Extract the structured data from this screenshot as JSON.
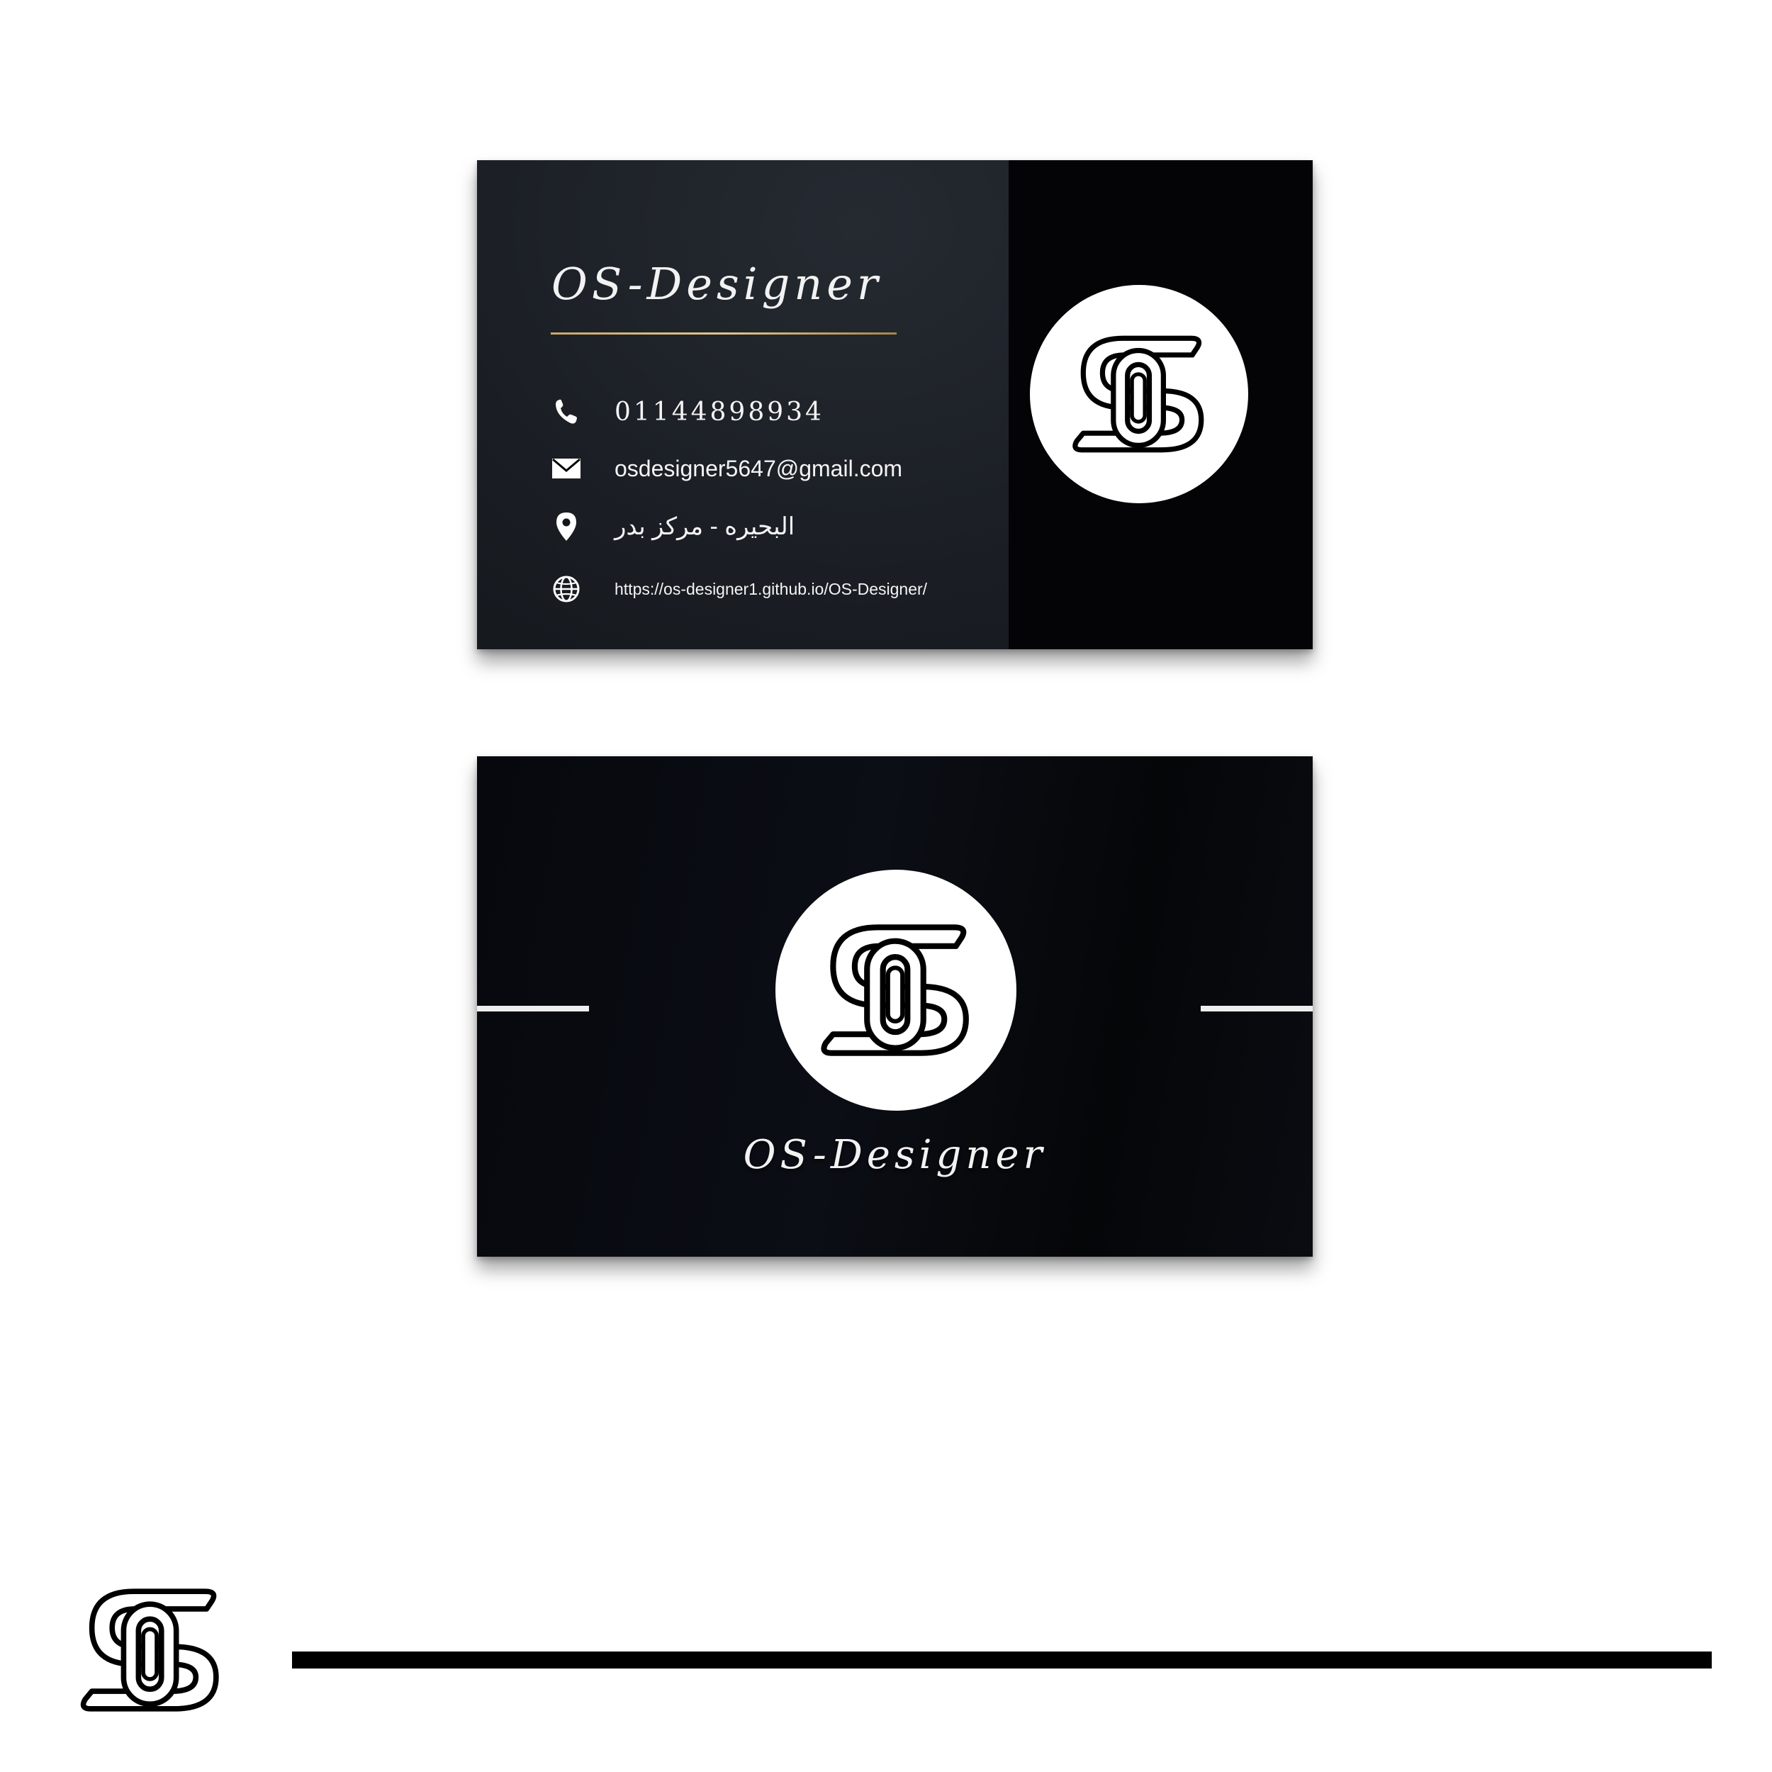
{
  "brand": {
    "name": "OS-Designer",
    "logo": "os-monogram-logo"
  },
  "front": {
    "title": "OS-Designer",
    "contacts": {
      "phone": "01144898934",
      "email": "osdesigner5647@gmail.com",
      "address": "البحيره - مركز بدر",
      "website": "https://os-designer1.github.io/OS-Designer/"
    },
    "icons": {
      "phone": "phone-icon",
      "email": "envelope-icon",
      "address": "location-pin-icon",
      "website": "globe-icon"
    }
  },
  "back": {
    "title": "OS-Designer"
  },
  "colors": {
    "card_background": "#040406",
    "accent_gold": "#c9a86a",
    "text": "#f2f2f2",
    "page_background": "#ffffff"
  }
}
